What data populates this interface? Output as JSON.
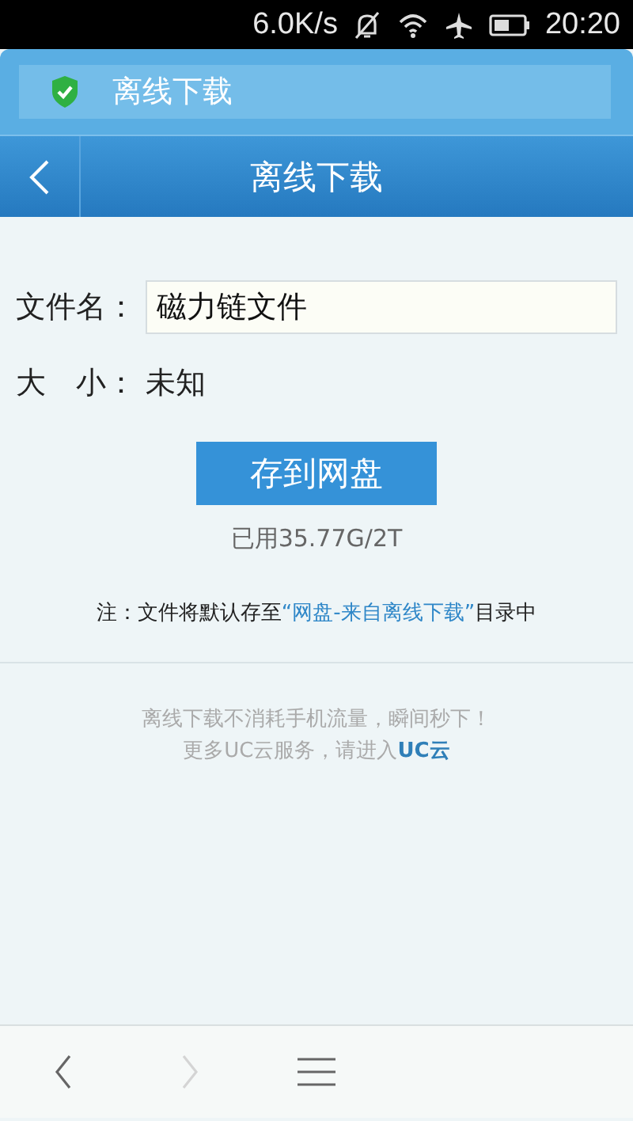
{
  "status_bar": {
    "speed": "6.0K/s",
    "time": "20:20"
  },
  "address_bar": {
    "title": "离线下载"
  },
  "header": {
    "title": "离线下载"
  },
  "form": {
    "file_label": "文件名：",
    "file_value": "磁力链文件",
    "size_label": "大　小：",
    "size_value": "未知"
  },
  "save_button": "存到网盘",
  "usage": "已用35.77G/2T",
  "note": {
    "before": "注：文件将默认存至",
    "link": "“网盘-来自离线下载”",
    "after": "目录中"
  },
  "promo": {
    "line1": "离线下载不消耗手机流量，瞬间秒下！",
    "line2": "更多UC云服务，请进入",
    "link": "UC云"
  },
  "toolbar": [
    {
      "kind": "back",
      "disabled": false
    },
    {
      "kind": "forward",
      "disabled": true
    },
    {
      "kind": "menu",
      "disabled": false
    }
  ]
}
